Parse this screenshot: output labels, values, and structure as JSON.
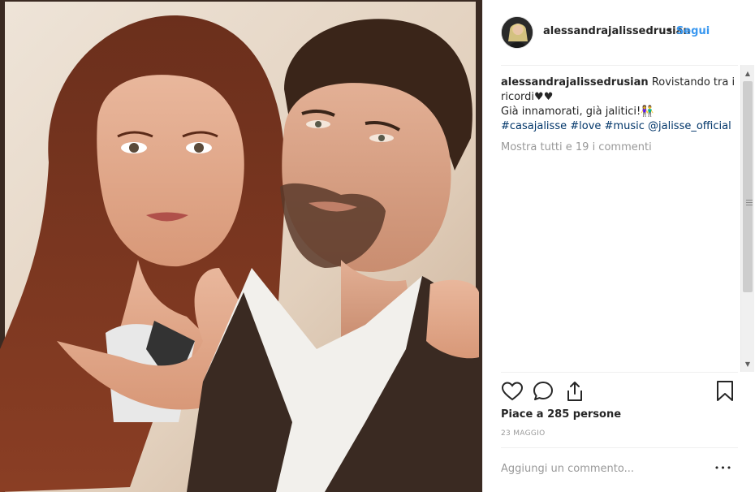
{
  "post": {
    "username": "alessandrajalissedrusian",
    "separator": "•",
    "follow_label": "Segui",
    "caption": {
      "username": "alessandrajalissedrusian",
      "line1": "Rovistando tra i ricordi",
      "line1_emoji": "♥♥",
      "line2": "Già innamorati, già jalitici!",
      "line2_emoji": "👫",
      "hashtag1": "#casajalisse",
      "hashtag2": "#love",
      "hashtag3": "#music",
      "mention": "@jalisse_official"
    },
    "more_comments": "Mostra tutti e 19 i commenti",
    "likes": "Piace a 285 persone",
    "date": "23 MAGGIO",
    "comment_placeholder": "Aggiungi un commento...",
    "more_options_icon": "•••"
  },
  "icons": {
    "like": "heart-icon",
    "comment": "comment-icon",
    "share": "share-icon",
    "save": "bookmark-icon",
    "more": "more-options-icon"
  },
  "colors": {
    "accent": "#3897f0",
    "text": "#262626",
    "muted": "#999999",
    "hashtag": "#003569"
  }
}
